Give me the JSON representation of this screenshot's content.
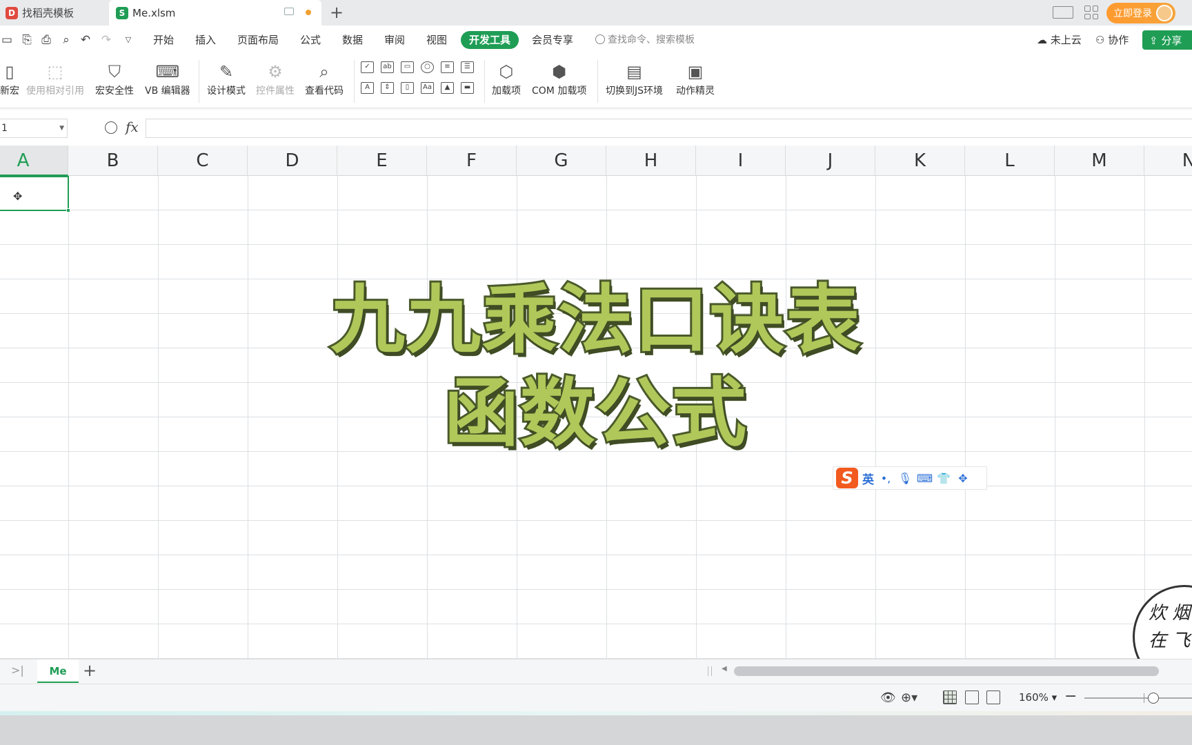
{
  "tabs": {
    "template_label": "找稻壳模板",
    "file_label": "Me.xlsm",
    "login_label": "立即登录"
  },
  "menu": {
    "items": [
      "开始",
      "插入",
      "页面布局",
      "公式",
      "数据",
      "审阅",
      "视图",
      "开发工具",
      "会员专享"
    ],
    "active": "开发工具",
    "search_placeholder": "查找命令、搜索模板",
    "cloud_label": "未上云",
    "collab_label": "协作",
    "share_label": "分享"
  },
  "ribbon": {
    "new_macro": "新宏",
    "relative_ref": "使用相对引用",
    "macro_security": "宏安全性",
    "vb_editor": "VB 编辑器",
    "design_mode": "设计模式",
    "control_props": "控件属性",
    "view_code": "查看代码",
    "addins": "加载项",
    "com_addins": "COM 加载项",
    "switch_js": "切换到JS环境",
    "action_wizard": "动作精灵"
  },
  "formula_bar": {
    "name_box": "1",
    "fx": "fx",
    "content": ""
  },
  "columns": [
    "A",
    "B",
    "C",
    "D",
    "E",
    "F",
    "G",
    "H",
    "I",
    "J",
    "K",
    "L",
    "M",
    "N"
  ],
  "selected_column": "A",
  "overlay": {
    "line1": "九九乘法口诀表",
    "line2": "函数公式"
  },
  "ime": {
    "logo": "S",
    "lang": "英"
  },
  "watermark": {
    "line1": "炊 烟",
    "line2": "在 飞"
  },
  "sheets": {
    "active": "Me"
  },
  "status": {
    "zoom": "160%",
    "zoom_fraction": 0.6
  },
  "colors": {
    "accent": "#1f9d55",
    "title_fill": "#b0c85a",
    "title_stroke": "#4a5a2a",
    "login": "#ff9a2e"
  },
  "icons": [
    "save-icon",
    "print-icon",
    "undo-icon",
    "redo-icon",
    "search-icon",
    "cloud-icon",
    "collab-icon",
    "share-icon",
    "zoom-icon",
    "eye-icon",
    "add-sheet-icon"
  ]
}
